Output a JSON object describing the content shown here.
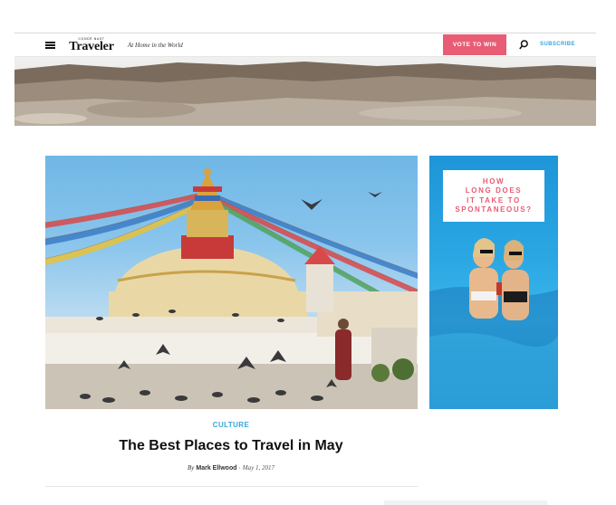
{
  "header": {
    "brand_small": "CONDÉ NAST",
    "brand_main": "Traveler",
    "tagline": "At Home in the World",
    "vote_label": "VOTE TO WIN",
    "subscribe_label": "SUBSCRIBE"
  },
  "icons": {
    "menu": "hamburger-menu-icon",
    "search": "search-icon"
  },
  "colors": {
    "accent_pink": "#e85d75",
    "link_blue": "#3aa6d8"
  },
  "ad": {
    "lines": [
      "HOW",
      "LONG DOES",
      "IT TAKE TO",
      "SPONTANEOUS?"
    ]
  },
  "article": {
    "category": "CULTURE",
    "title": "The Best Places to Travel in May",
    "by": "By",
    "author": "Mark Ellwood",
    "separator": "·",
    "date": "May 1, 2017"
  }
}
